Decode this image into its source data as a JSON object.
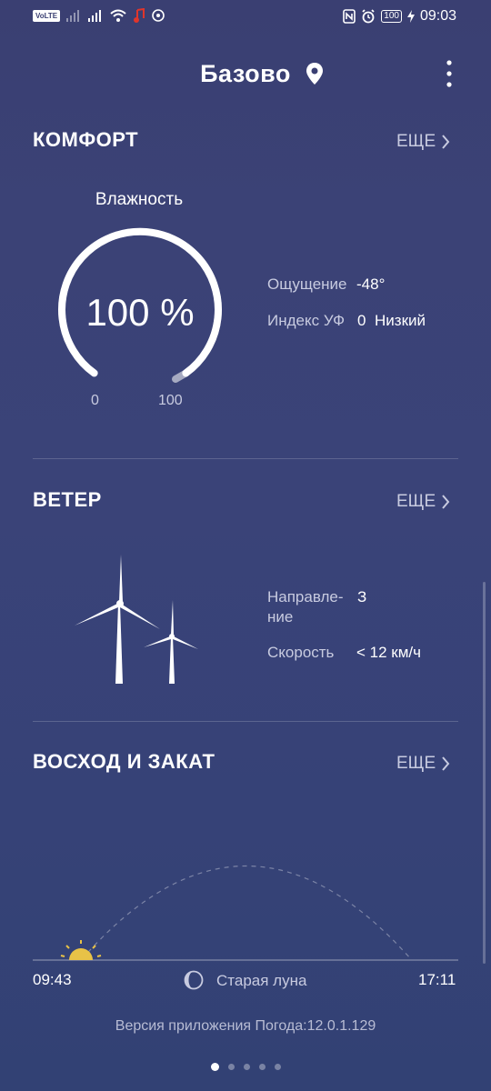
{
  "status_bar": {
    "volte": "VoLTE",
    "battery": "100",
    "time": "09:03"
  },
  "header": {
    "city": "Базово",
    "location_icon": "location-pin-icon",
    "menu_icon": "more-vertical-icon"
  },
  "comfort": {
    "title": "КОМФОРТ",
    "more_label": "ЕЩЕ",
    "humidity_label": "Влажность",
    "humidity_value": "100 %",
    "humidity_level": 1.0,
    "gauge_min": "0",
    "gauge_max": "100",
    "feels_label": "Ощущение",
    "feels_value": "-48°",
    "uv_label": "Индекс УФ",
    "uv_value": "0",
    "uv_level": "Низкий"
  },
  "wind": {
    "title": "ВЕТЕР",
    "more_label": "ЕЩЕ",
    "direction_label_1": "Направле-",
    "direction_label_2": "ние",
    "direction_value": "З",
    "speed_label": "Скорость",
    "speed_value": "< 12 км/ч"
  },
  "sun": {
    "title": "ВОСХОД И ЗАКАТ",
    "more_label": "ЕЩЕ",
    "sunrise": "09:43",
    "sunset": "17:11",
    "moon_phase": "Старая луна"
  },
  "footer": {
    "version": "Версия приложения Погода:12.0.1.129"
  },
  "pager": {
    "count": 5,
    "active": 0
  }
}
